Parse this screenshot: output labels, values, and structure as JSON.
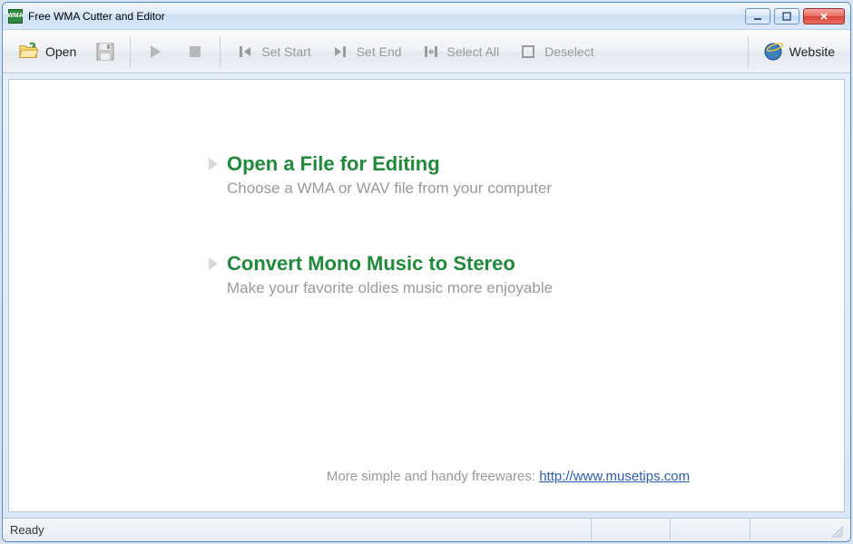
{
  "window": {
    "title": "Free WMA Cutter and Editor"
  },
  "toolbar": {
    "open": "Open",
    "set_start": "Set Start",
    "set_end": "Set End",
    "select_all": "Select All",
    "deselect": "Deselect",
    "website": "Website"
  },
  "content": {
    "actions": [
      {
        "title": "Open a File for Editing",
        "subtitle": "Choose a WMA or WAV file from your computer"
      },
      {
        "title": "Convert Mono Music to Stereo",
        "subtitle": "Make your favorite oldies music more enjoyable"
      }
    ],
    "footer_text": "More simple and handy freewares:  ",
    "footer_url": "http://www.musetips.com"
  },
  "status": {
    "text": "Ready"
  }
}
